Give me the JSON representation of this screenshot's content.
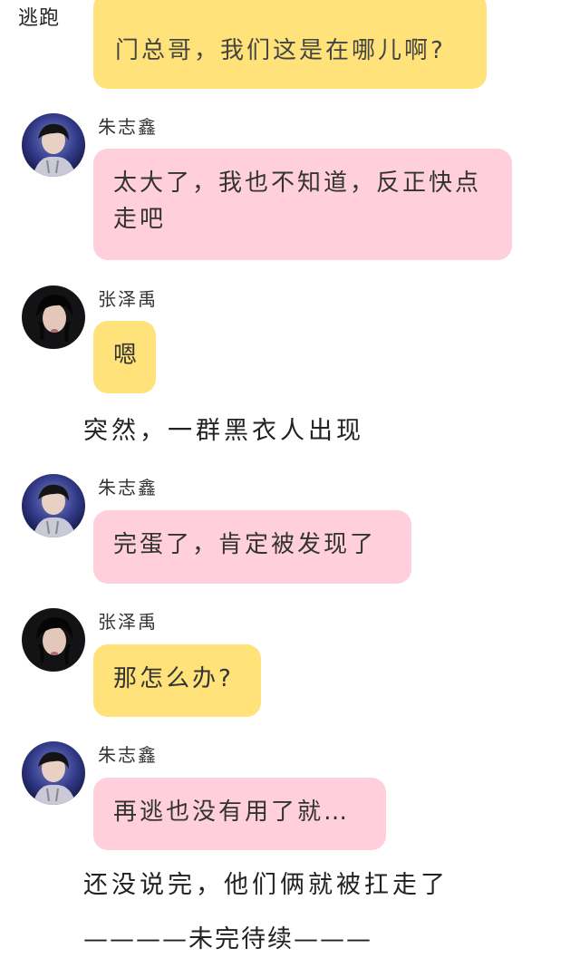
{
  "title": "逃跑",
  "colors": {
    "yellow_bubble": "#ffe27a",
    "pink_bubble": "#ffd0dc"
  },
  "messages": [
    {
      "speaker": "",
      "text": "门总哥，我们这是在哪儿啊?"
    },
    {
      "speaker": "朱志鑫",
      "text": "太大了，我也不知道，反正快点走吧"
    },
    {
      "speaker": "张泽禹",
      "text": "嗯"
    },
    {
      "narration": "突然，一群黑衣人出现"
    },
    {
      "speaker": "朱志鑫",
      "text": "完蛋了，肯定被发现了"
    },
    {
      "speaker": "张泽禹",
      "text": "那怎么办?"
    },
    {
      "speaker": "朱志鑫",
      "text": "再逃也没有用了就…"
    },
    {
      "narration": "还没说完，他们俩就被扛走了"
    },
    {
      "narration": "————未完待续———"
    }
  ],
  "avatars": {
    "zhu": "avatar-zhu-zhixin",
    "zhang": "avatar-zhang-zeyu"
  }
}
